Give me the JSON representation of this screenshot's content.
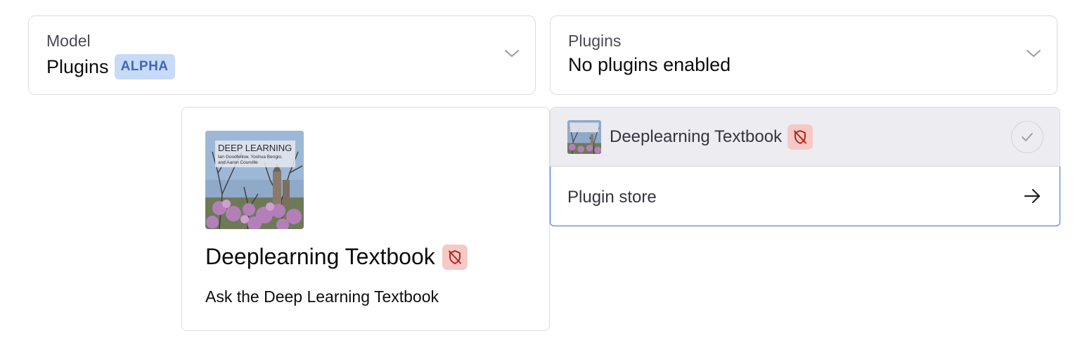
{
  "model_select": {
    "label": "Model",
    "value": "Plugins",
    "badge": "ALPHA",
    "icon": "chevron-down-icon"
  },
  "plugins_select": {
    "label": "Plugins",
    "value": "No plugins enabled",
    "icon": "chevron-down-icon"
  },
  "plugin_card": {
    "cover": {
      "title": "DEEP LEARNING",
      "authors_line1": "Ian Goodfellow, Yoshua Bengio,",
      "authors_line2": "and Aaron Courville"
    },
    "name": "Deeplearning Textbook",
    "description": "Ask the Deep Learning Textbook",
    "badge_icon": "unverified-shield-icon"
  },
  "dropdown": {
    "items": [
      {
        "name": "Deeplearning Textbook",
        "badge_icon": "unverified-shield-icon",
        "action_icon": "check-icon"
      }
    ],
    "store": {
      "label": "Plugin store",
      "icon": "arrow-right-icon"
    }
  },
  "colors": {
    "border": "#dcdce0",
    "alpha_badge_bg": "#c7dbf7",
    "alpha_badge_text": "#4466b3",
    "unverified_bg": "#f6c9c6",
    "unverified_icon": "#b3261e",
    "highlight_bg": "#ececf1",
    "focus_border": "#3b6fd6"
  }
}
